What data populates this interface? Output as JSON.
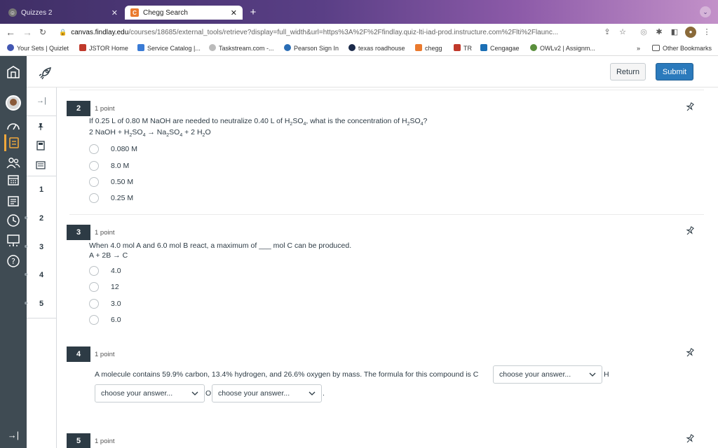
{
  "browser": {
    "tabs": [
      {
        "title": "Quizzes 2",
        "active": false
      },
      {
        "title": "Chegg Search",
        "active": true
      }
    ],
    "url_domain": "canvas.findlay.edu",
    "url_path": "/courses/18685/external_tools/retrieve?display=full_width&url=https%3A%2F%2Ffindlay.quiz-lti-iad-prod.instructure.com%2Flti%2Flaunc...",
    "bookmarks": [
      {
        "label": "Your Sets | Quizlet",
        "color": "#4257b2"
      },
      {
        "label": "JSTOR Home",
        "color": "#c0392b"
      },
      {
        "label": "Service Catalog |...",
        "color": "#3a7bd5"
      },
      {
        "label": "Taskstream.com -...",
        "color": "#bbbbbb"
      },
      {
        "label": "Pearson Sign In",
        "color": "#2a6db5"
      },
      {
        "label": "texas roadhouse",
        "color": "#1b2a4a"
      },
      {
        "label": "chegg",
        "color": "#ea7a2e"
      },
      {
        "label": "TR",
        "color": "#c0392b"
      },
      {
        "label": "Cengagae",
        "color": "#1b6fb5"
      },
      {
        "label": "OWLv2 | Assignm...",
        "color": "#5a8f3c"
      }
    ],
    "bookmarks_more": "»",
    "other_bookmarks": "Other Bookmarks"
  },
  "header": {
    "return_label": "Return",
    "submit_label": "Submit"
  },
  "qnav": {
    "numbers": [
      "1",
      "2",
      "3",
      "4",
      "5"
    ]
  },
  "questions": {
    "q2": {
      "number": "2",
      "points": "1 point",
      "text_a": "If 0.25 L of 0.80 M NaOH are needed to neutralize 0.40 L of H",
      "text_b": "SO",
      "text_c": ", what is the concentration of H",
      "text_d": "SO",
      "text_e": "?",
      "sub2": "2",
      "sub4": "4",
      "eq_a": "2 NaOH + H",
      "eq_b": "SO",
      "eq_c": " → Na",
      "eq_d": "SO",
      "eq_e": " + 2 H",
      "eq_f": "O",
      "options": [
        "0.080 M",
        "8.0 M",
        "0.50 M",
        "0.25 M"
      ]
    },
    "q3": {
      "number": "3",
      "points": "1 point",
      "text": "When 4.0 mol A and 6.0 mol B react, a maximum of ___ mol C can be produced.",
      "equation": "A + 2B → C",
      "options": [
        "4.0",
        "12",
        "3.0",
        "6.0"
      ]
    },
    "q4": {
      "number": "4",
      "points": "1 point",
      "text": "A molecule contains 59.9% carbon, 13.4% hydrogen, and 26.6% oxygen by mass. The formula for this compound is C",
      "after_select1": "H",
      "after_select2": "O",
      "after_select3": ".",
      "select_placeholder": "choose your answer..."
    },
    "q5": {
      "number": "5",
      "points": "1 point"
    }
  }
}
